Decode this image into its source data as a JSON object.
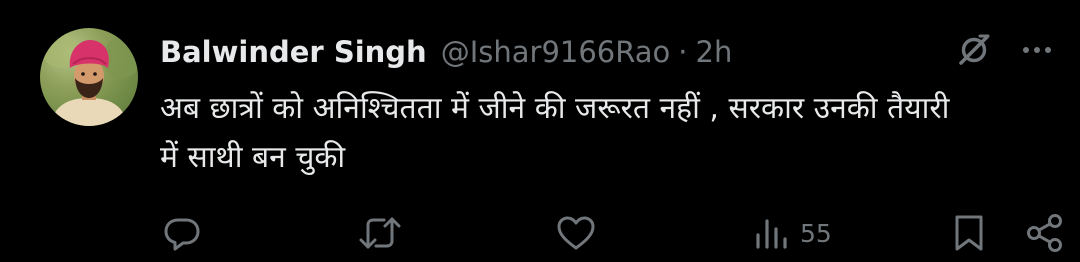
{
  "tweet": {
    "author": {
      "display_name": "Balwinder Singh",
      "handle": "@Ishar9166Rao",
      "separator": "·",
      "timestamp": "2h"
    },
    "text_lines": [
      "अब छात्रों को अनिश्चितता में जीने की जरूरत नहीं , सरकार उनकी तैयारी",
      "में साथी बन चुकी"
    ],
    "actions": {
      "views_count": "55"
    },
    "icons": {
      "top": [
        "grok-icon",
        "more-icon"
      ],
      "bottom": [
        "reply-icon",
        "retweet-icon",
        "like-icon",
        "views-icon",
        "bookmark-icon",
        "share-icon"
      ]
    },
    "colors": {
      "background": "#000000",
      "primary_text": "#e7e9ea",
      "secondary_text": "#71767b",
      "avatar_turban": "#d8326a"
    }
  }
}
